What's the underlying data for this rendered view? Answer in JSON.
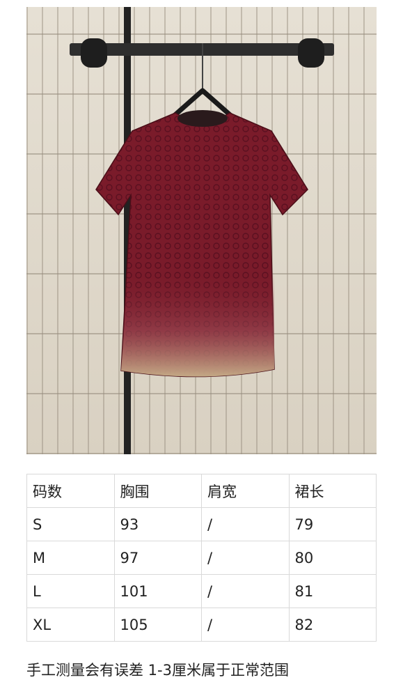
{
  "product_photo": {
    "icon": "red-monogram-dress-photo",
    "colors": {
      "dress": "#7a1b2a",
      "dress_shadow": "#5c1220",
      "wall": "#ddd6c8",
      "rail": "#2b2b2b"
    }
  },
  "size_table": {
    "headers": [
      "码数",
      "胸围",
      "肩宽",
      "裙长"
    ],
    "rows": [
      [
        "S",
        "93",
        "/",
        "79"
      ],
      [
        "M",
        "97",
        "/",
        "80"
      ],
      [
        "L",
        "101",
        "/",
        "81"
      ],
      [
        "XL",
        "105",
        "/",
        "82"
      ]
    ]
  },
  "footnote": "手工测量会有误差 1-3厘米属于正常范围"
}
